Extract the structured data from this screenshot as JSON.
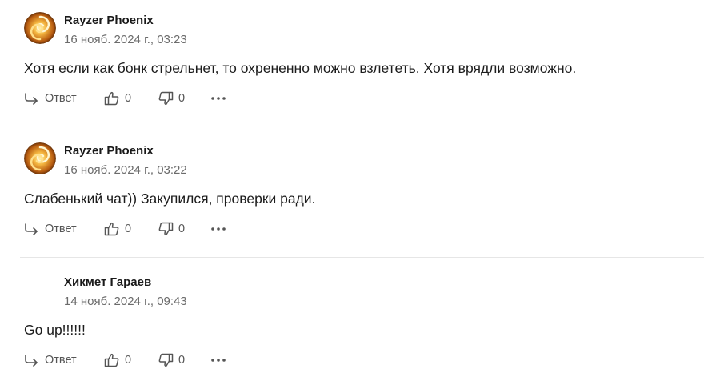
{
  "comments": [
    {
      "author": "Rayzer Phoenix",
      "date": "16 нояб. 2024 г., 03:23",
      "text": "Хотя если как бонк стрельнет, то охрененно можно взлететь. Хотя врядли возможно.",
      "reply_label": "Ответ",
      "likes": "0",
      "dislikes": "0",
      "has_avatar": true
    },
    {
      "author": "Rayzer Phoenix",
      "date": "16 нояб. 2024 г., 03:22",
      "text": "Слабенький чат)) Закупился, проверки ради.",
      "reply_label": "Ответ",
      "likes": "0",
      "dislikes": "0",
      "has_avatar": true
    },
    {
      "author": "Хикмет Гараев",
      "date": "14 нояб. 2024 г., 09:43",
      "text": "Go up!!!!!!",
      "reply_label": "Ответ",
      "likes": "0",
      "dislikes": "0",
      "has_avatar": false
    }
  ],
  "icons": {
    "reply": "reply-arrow-icon",
    "like": "thumbs-up-icon",
    "dislike": "thumbs-down-icon",
    "more": "more-dots-icon"
  },
  "colors": {
    "text": "#1c1c1c",
    "muted": "#6b6b6b",
    "icon": "#555555",
    "divider": "#e6e6e6",
    "avatar_gold": "#e8a030"
  }
}
